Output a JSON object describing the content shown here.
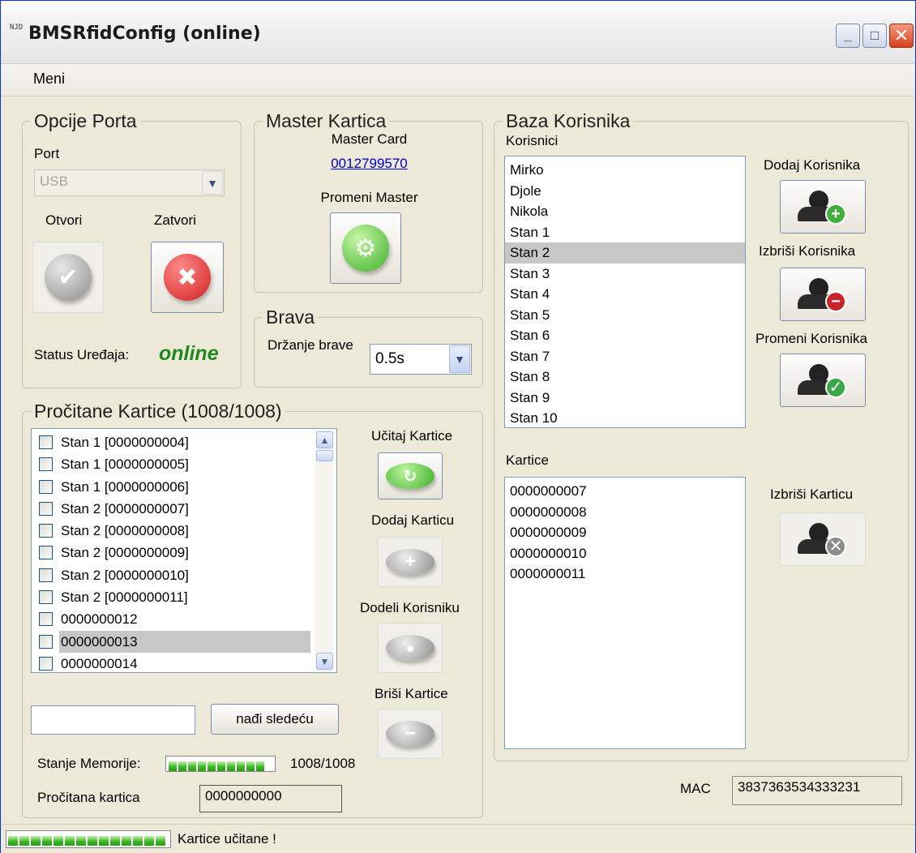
{
  "window": {
    "title": "BMSRfidConfig (online)",
    "icon_text": "NJD",
    "minimize": "_",
    "maximize": "□",
    "close": "✕"
  },
  "menu": {
    "items": [
      "Meni"
    ]
  },
  "port_options": {
    "title": "Opcije Porta",
    "port_label": "Port",
    "port_value": "USB",
    "open_label": "Otvori",
    "close_label": "Zatvori",
    "status_label": "Status Uređaja:",
    "status_value": "online",
    "status_color": "#1e8a1e"
  },
  "master_card": {
    "title": "Master Kartica",
    "label": "Master Card",
    "value": "0012799570",
    "change_label": "Promeni Master"
  },
  "lock": {
    "title": "Brava",
    "hold_label": "Držanje brave",
    "hold_value": "0.5s"
  },
  "read_cards": {
    "title": "Pročitane Kartice (1008/1008)",
    "items": [
      {
        "text": "Stan 1 [0000000004]",
        "checked": false,
        "selected": false
      },
      {
        "text": "Stan 1 [0000000005]",
        "checked": false,
        "selected": false
      },
      {
        "text": "Stan 1 [0000000006]",
        "checked": false,
        "selected": false
      },
      {
        "text": "Stan 2 [0000000007]",
        "checked": false,
        "selected": false
      },
      {
        "text": "Stan 2 [0000000008]",
        "checked": false,
        "selected": false
      },
      {
        "text": "Stan 2 [0000000009]",
        "checked": false,
        "selected": false
      },
      {
        "text": "Stan 2 [0000000010]",
        "checked": false,
        "selected": false
      },
      {
        "text": "Stan 2 [0000000011]",
        "checked": false,
        "selected": false
      },
      {
        "text": "0000000012",
        "checked": false,
        "selected": false
      },
      {
        "text": "0000000013",
        "checked": false,
        "selected": true
      },
      {
        "text": "0000000014",
        "checked": false,
        "selected": false
      }
    ],
    "load_label": "Učitaj Kartice",
    "add_label": "Dodaj Karticu",
    "assign_label": "Dodeli Korisniku",
    "delete_label": "Briši Kartice",
    "search_value": "",
    "find_next_label": "nađi sledeću",
    "memory_label": "Stanje Memorije:",
    "memory_value": "1008/1008",
    "memory_fill": 1.0,
    "read_card_label": "Pročitana kartica",
    "read_card_value": "0000000000"
  },
  "users_db": {
    "title": "Baza Korisnika",
    "users_label": "Korisnici",
    "users": [
      "Mirko",
      "Djole",
      "Nikola",
      "Stan 1",
      "Stan 2",
      "Stan 3",
      "Stan 4",
      "Stan 5",
      "Stan 6",
      "Stan 7",
      "Stan 8",
      "Stan 9",
      "Stan 10"
    ],
    "selected_user": "Stan 2",
    "add_user_label": "Dodaj Korisnika",
    "delete_user_label": "Izbriši Korisnika",
    "change_user_label": "Promeni Korisnika",
    "cards_label": "Kartice",
    "cards": [
      "0000000007",
      "0000000008",
      "0000000009",
      "0000000010",
      "0000000011"
    ],
    "delete_card_label": "Izbriši Karticu"
  },
  "mac": {
    "label": "MAC",
    "value": "3837363534333231"
  },
  "statusbar": {
    "text": "Kartice učitane !",
    "progress_fill": 1.0
  },
  "colors": {
    "ok_green": "#3aa62a",
    "cancel_red": "#d21f1f",
    "gear_green": "#5cc83a",
    "remove_red": "#c8242a",
    "check_green": "#39a848",
    "grey_icon": "#8d8d8d",
    "link_blue": "#0000cc"
  }
}
